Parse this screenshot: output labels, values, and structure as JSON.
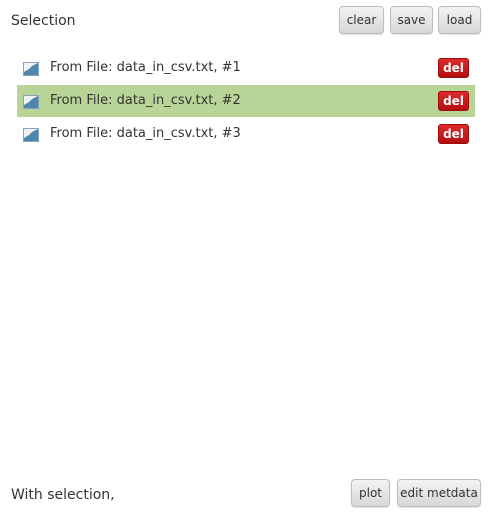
{
  "header": {
    "title": "Selection",
    "buttons": {
      "clear": "clear",
      "save": "save",
      "load": "load"
    }
  },
  "list": {
    "items": [
      {
        "label": "From File: data_in_csv.txt, #1",
        "delete_label": "del",
        "selected": false,
        "icon": "area-chart-icon"
      },
      {
        "label": "From File: data_in_csv.txt, #2",
        "delete_label": "del",
        "selected": true,
        "icon": "area-chart-icon"
      },
      {
        "label": "From File: data_in_csv.txt, #3",
        "delete_label": "del",
        "selected": false,
        "icon": "area-chart-icon"
      }
    ]
  },
  "footer": {
    "title": "With selection,",
    "buttons": {
      "plot": "plot",
      "edit_metadata": "edit metdata"
    }
  },
  "colors": {
    "selected_row": "#b8d496",
    "delete_button": "#c81b1b",
    "button_bg": "#e3e3e3"
  }
}
